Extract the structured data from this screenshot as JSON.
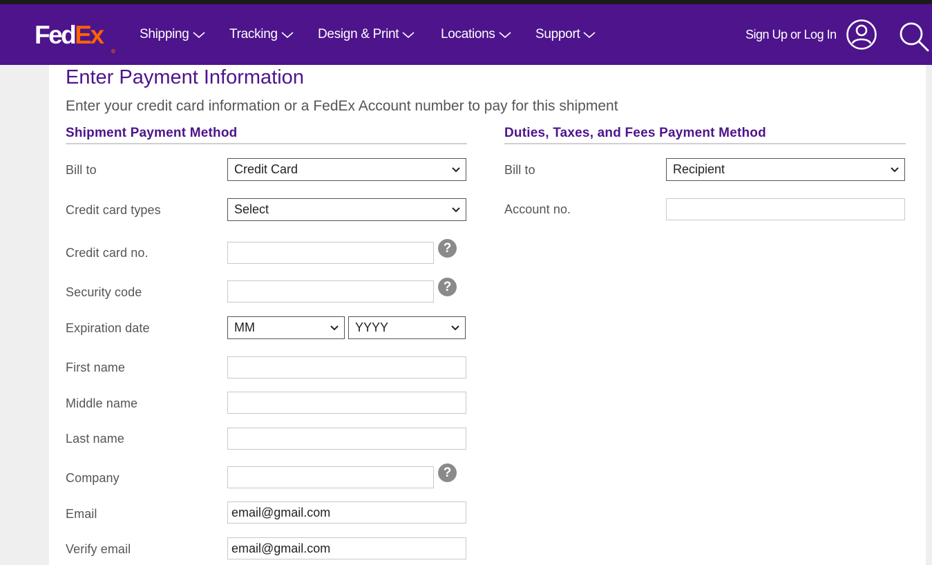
{
  "brand": {
    "logo_fed": "Fed",
    "logo_ex": "Ex",
    "logo_reg": "®"
  },
  "nav": {
    "items": [
      {
        "label": "Shipping"
      },
      {
        "label": "Tracking"
      },
      {
        "label": "Design & Print"
      },
      {
        "label": "Locations"
      },
      {
        "label": "Support"
      }
    ],
    "signin_label": "Sign Up or Log In",
    "user_icon": "user-circle-icon",
    "search_icon": "search-icon"
  },
  "page": {
    "title": "Enter Payment Information",
    "subtitle": "Enter your credit card information or a FedEx Account number to pay for this shipment"
  },
  "shipment": {
    "title": "Shipment Payment Method",
    "bill_to_label": "Bill to",
    "bill_to_value": "Credit Card",
    "card_types_label": "Credit card types",
    "card_types_value": "Select",
    "card_no_label": "Credit card no.",
    "card_no_value": "",
    "security_label": "Security code",
    "security_value": "",
    "expiration_label": "Expiration date",
    "exp_month_value": "MM",
    "exp_year_value": "YYYY",
    "first_name_label": "First name",
    "first_name_value": "",
    "middle_name_label": "Middle name",
    "middle_name_value": "",
    "last_name_label": "Last name",
    "last_name_value": "",
    "company_label": "Company",
    "company_value": "",
    "email_label": "Email",
    "email_value": "email@gmail.com",
    "verify_email_label": "Verify email",
    "verify_email_value": "email@gmail.com",
    "help_glyph": "?"
  },
  "duties": {
    "title": "Duties, Taxes, and Fees Payment Method",
    "bill_to_label": "Bill to",
    "bill_to_value": "Recipient",
    "account_label": "Account no.",
    "account_value": ""
  },
  "colors": {
    "brand_purple": "#4d148c",
    "brand_orange": "#ff6200",
    "help_gray": "#8a8a8a"
  }
}
